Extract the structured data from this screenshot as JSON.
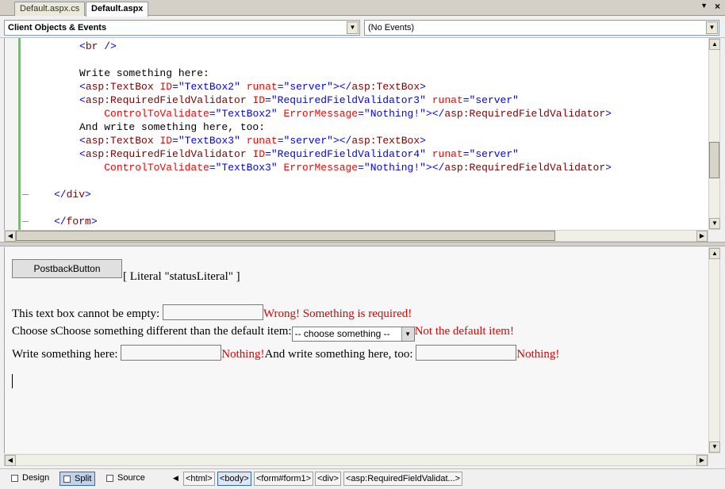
{
  "tabs": [
    {
      "label": "Default.aspx.cs",
      "active": false
    },
    {
      "label": "Default.aspx",
      "active": true
    }
  ],
  "icons": {
    "tab_menu": "down-triangle-icon",
    "tab_close": "close-icon"
  },
  "dropdowns": {
    "left": "Client Objects & Events",
    "right": "(No Events)"
  },
  "code_lines": [
    {
      "segs": [
        [
          "tag",
          "<"
        ],
        [
          "el",
          "br"
        ],
        [
          "tag",
          " />"
        ]
      ]
    },
    {
      "segs": []
    },
    {
      "segs": [
        [
          "tx",
          "Write something here:"
        ]
      ]
    },
    {
      "segs": [
        [
          "tag",
          "<"
        ],
        [
          "el",
          "asp:TextBox"
        ],
        [
          "tx",
          " "
        ],
        [
          "at",
          "ID"
        ],
        [
          "tag",
          "=\"TextBox2\""
        ],
        [
          "tx",
          " "
        ],
        [
          "at",
          "runat"
        ],
        [
          "tag",
          "=\"server\"></"
        ],
        [
          "el",
          "asp:TextBox"
        ],
        [
          "tag",
          ">"
        ]
      ]
    },
    {
      "segs": [
        [
          "tag",
          "<"
        ],
        [
          "el",
          "asp:RequiredFieldValidator"
        ],
        [
          "tx",
          " "
        ],
        [
          "at",
          "ID"
        ],
        [
          "tag",
          "=\"RequiredFieldValidator3\""
        ],
        [
          "tx",
          " "
        ],
        [
          "at",
          "runat"
        ],
        [
          "tag",
          "=\"server\""
        ]
      ]
    },
    {
      "segs": [
        [
          "tx",
          "    "
        ],
        [
          "at",
          "ControlToValidate"
        ],
        [
          "tag",
          "=\"TextBox2\""
        ],
        [
          "tx",
          " "
        ],
        [
          "at",
          "ErrorMessage"
        ],
        [
          "tag",
          "=\"Nothing!\"></"
        ],
        [
          "el",
          "asp:RequiredFieldValidator"
        ],
        [
          "tag",
          ">"
        ]
      ]
    },
    {
      "segs": [
        [
          "tx",
          "And write something here, too:"
        ]
      ]
    },
    {
      "segs": [
        [
          "tag",
          "<"
        ],
        [
          "el",
          "asp:TextBox"
        ],
        [
          "tx",
          " "
        ],
        [
          "at",
          "ID"
        ],
        [
          "tag",
          "=\"TextBox3\""
        ],
        [
          "tx",
          " "
        ],
        [
          "at",
          "runat"
        ],
        [
          "tag",
          "=\"server\"></"
        ],
        [
          "el",
          "asp:TextBox"
        ],
        [
          "tag",
          ">"
        ]
      ]
    },
    {
      "segs": [
        [
          "tag",
          "<"
        ],
        [
          "el",
          "asp:RequiredFieldValidator"
        ],
        [
          "tx",
          " "
        ],
        [
          "at",
          "ID"
        ],
        [
          "tag",
          "=\"RequiredFieldValidator4\""
        ],
        [
          "tx",
          " "
        ],
        [
          "at",
          "runat"
        ],
        [
          "tag",
          "=\"server\""
        ]
      ]
    },
    {
      "segs": [
        [
          "tx",
          "    "
        ],
        [
          "at",
          "ControlToValidate"
        ],
        [
          "tag",
          "=\"TextBox3\""
        ],
        [
          "tx",
          " "
        ],
        [
          "at",
          "ErrorMessage"
        ],
        [
          "tag",
          "=\"Nothing!\"></"
        ],
        [
          "el",
          "asp:RequiredFieldValidator"
        ],
        [
          "tag",
          ">"
        ]
      ]
    },
    {
      "segs": []
    },
    {
      "segs": [
        [
          "tag",
          "</"
        ],
        [
          "el",
          "div"
        ],
        [
          "tag",
          ">"
        ]
      ]
    },
    {
      "segs": []
    },
    {
      "segs": [
        [
          "tag",
          "</"
        ],
        [
          "el",
          "form"
        ],
        [
          "tag",
          ">"
        ]
      ]
    }
  ],
  "design": {
    "postback_button": "PostbackButton",
    "literal": "[ Literal \"statusLiteral\" ]",
    "line1_label": "This text box cannot be empty: ",
    "line1_error": "Wrong! Something is required!",
    "line2_label": "Choose sChoose something different than the default item:",
    "line2_select": "-- choose something --",
    "line2_error": "Not the default item!",
    "line3_label": "Write something here: ",
    "line3_error": "Nothing!",
    "line3_label2": "And write something here, too: ",
    "line3_error2": "Nothing!"
  },
  "view_buttons": [
    {
      "label": "Design",
      "icon": "design-view-icon",
      "active": false
    },
    {
      "label": "Split",
      "icon": "split-view-icon",
      "active": true
    },
    {
      "label": "Source",
      "icon": "source-view-icon",
      "active": false
    }
  ],
  "breadcrumbs": [
    {
      "label": "<html>",
      "selected": false
    },
    {
      "label": "<body>",
      "selected": true
    },
    {
      "label": "<form#form1>",
      "selected": false
    },
    {
      "label": "<div>",
      "selected": false
    },
    {
      "label": "<asp:RequiredFieldValidat...>",
      "selected": false
    }
  ]
}
